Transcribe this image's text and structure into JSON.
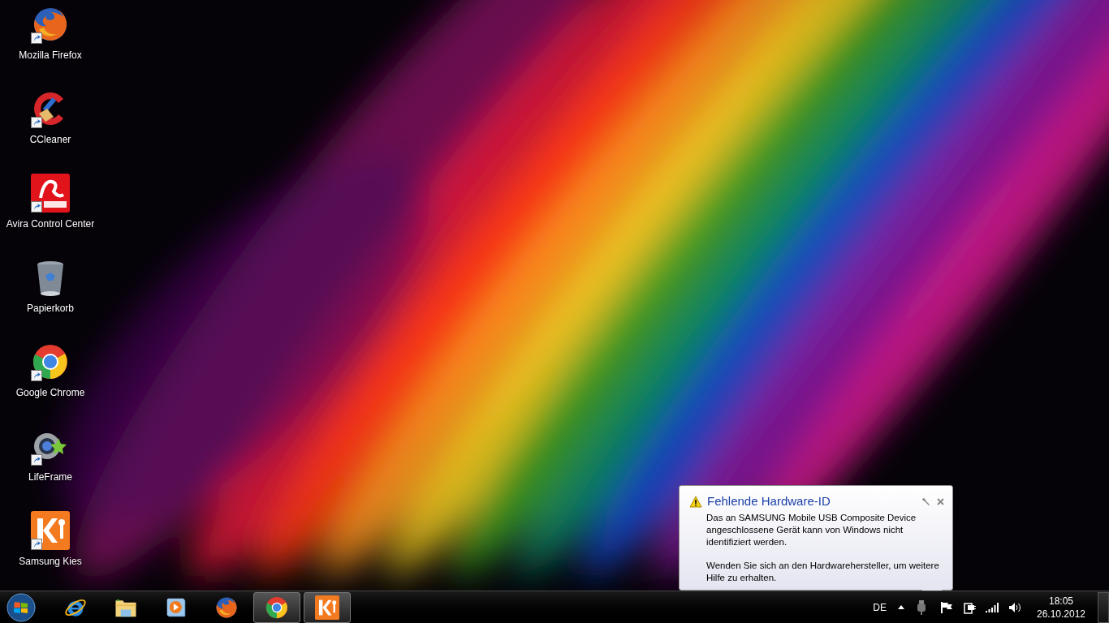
{
  "desktop_icons": [
    {
      "kind": "firefox",
      "label": "Mozilla Firefox",
      "shortcut": true
    },
    {
      "kind": "ccleaner",
      "label": "CCleaner",
      "shortcut": true
    },
    {
      "kind": "avira",
      "label": "Avira Control Center",
      "shortcut": true
    },
    {
      "kind": "recycle",
      "label": "Papierkorb",
      "shortcut": false
    },
    {
      "kind": "chrome",
      "label": "Google Chrome",
      "shortcut": true
    },
    {
      "kind": "lifeframe",
      "label": "LifeFrame",
      "shortcut": true
    },
    {
      "kind": "kies",
      "label": "Samsung Kies",
      "shortcut": true
    }
  ],
  "notification": {
    "title": "Fehlende Hardware-ID",
    "paragraphs": [
      "Das an SAMSUNG Mobile USB Composite Device angeschlossene Gerät kann von Windows nicht identifiziert werden.",
      "Wenden Sie sich an den Hardwarehersteller, um weitere Hilfe zu erhalten."
    ]
  },
  "taskbar": {
    "items": [
      {
        "kind": "ie",
        "running": false
      },
      {
        "kind": "explorer",
        "running": false
      },
      {
        "kind": "mediaplayer",
        "running": false
      },
      {
        "kind": "firefox",
        "running": false
      },
      {
        "kind": "chrome",
        "running": true
      },
      {
        "kind": "kies",
        "running": true
      }
    ],
    "language": "DE",
    "clock": {
      "time": "18:05",
      "date": "26.10.2012"
    }
  }
}
